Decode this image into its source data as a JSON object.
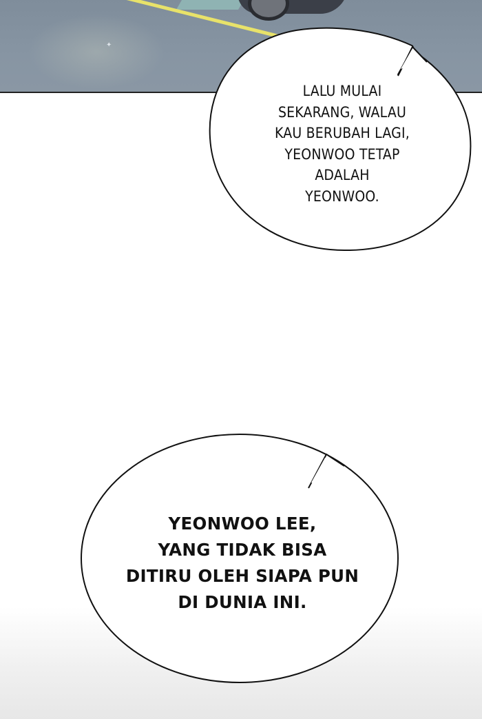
{
  "panels": {
    "top": {
      "scene": "parking-lot-with-car"
    }
  },
  "bubble1": {
    "lines": [
      "LALU MULAI",
      "SEKARANG, WALAU",
      "KAU BERUBAH LAGI,",
      "YEONWOO TETAP",
      "ADALAH",
      "YEONWOO."
    ]
  },
  "bubble2": {
    "lines": [
      "YEONWOO LEE,",
      "YANG TIDAK BISA",
      "DITIRU OLEH SIAPA PUN",
      "DI DUNIA INI."
    ]
  },
  "colors": {
    "panel_gray": "#8795a3",
    "road_line": "#e8e26a",
    "bubble_fill": "#ffffff",
    "bubble_stroke": "#111111",
    "text": "#111111"
  }
}
